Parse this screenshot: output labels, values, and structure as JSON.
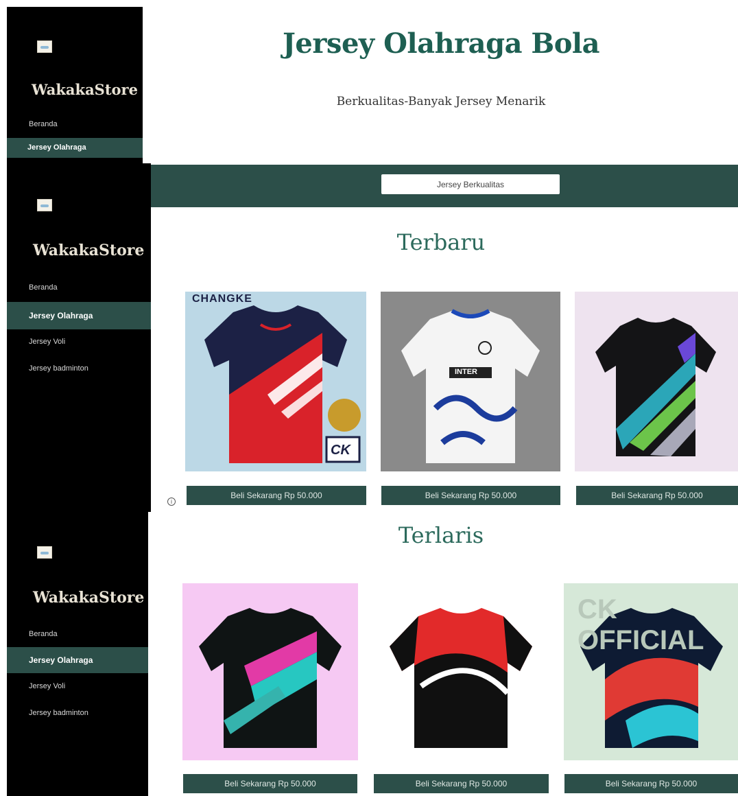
{
  "sidebar_top": {
    "brand": "WakakaStore",
    "items": [
      {
        "label": "Beranda"
      },
      {
        "label": "Jersey Olahraga"
      }
    ]
  },
  "sidebar_mid": {
    "brand": "WakakaStore",
    "items": [
      {
        "label": "Beranda"
      },
      {
        "label": "Jersey Olahraga"
      },
      {
        "label": "Jersey Voli"
      },
      {
        "label": "Jersey badminton"
      }
    ]
  },
  "sidebar_bot": {
    "brand": "WakakaStore",
    "items": [
      {
        "label": "Beranda"
      },
      {
        "label": "Jersey Olahraga"
      },
      {
        "label": "Jersey Voli"
      },
      {
        "label": "Jersey badminton"
      }
    ]
  },
  "header": {
    "title": "Jersey Olahraga Bola",
    "subtitle": "Berkualitas-Banyak Jersey Menarik"
  },
  "band": {
    "button_label": "Jersey Berkualitas"
  },
  "sections": [
    {
      "title": "Terbaru",
      "products": [
        {
          "buy_label": "Beli Sekarang Rp 50.000"
        },
        {
          "buy_label": "Beli Sekarang Rp 50.000"
        },
        {
          "buy_label": "Beli Sekarang Rp 50.000"
        }
      ]
    },
    {
      "title": "Terlaris",
      "products": [
        {
          "buy_label": "Beli Sekarang Rp 50.000"
        },
        {
          "buy_label": "Beli Sekarang Rp 50.000"
        },
        {
          "buy_label": "Beli Sekarang Rp 50.000"
        }
      ]
    }
  ],
  "image_text": {
    "changke": "CHANGKE",
    "ck": "CK",
    "inter": "INTER",
    "ck_official": "CK OFFICIAL"
  },
  "colors": {
    "accent": "#2c4f49",
    "title": "#1e5f52",
    "sidebar": "#000000"
  }
}
